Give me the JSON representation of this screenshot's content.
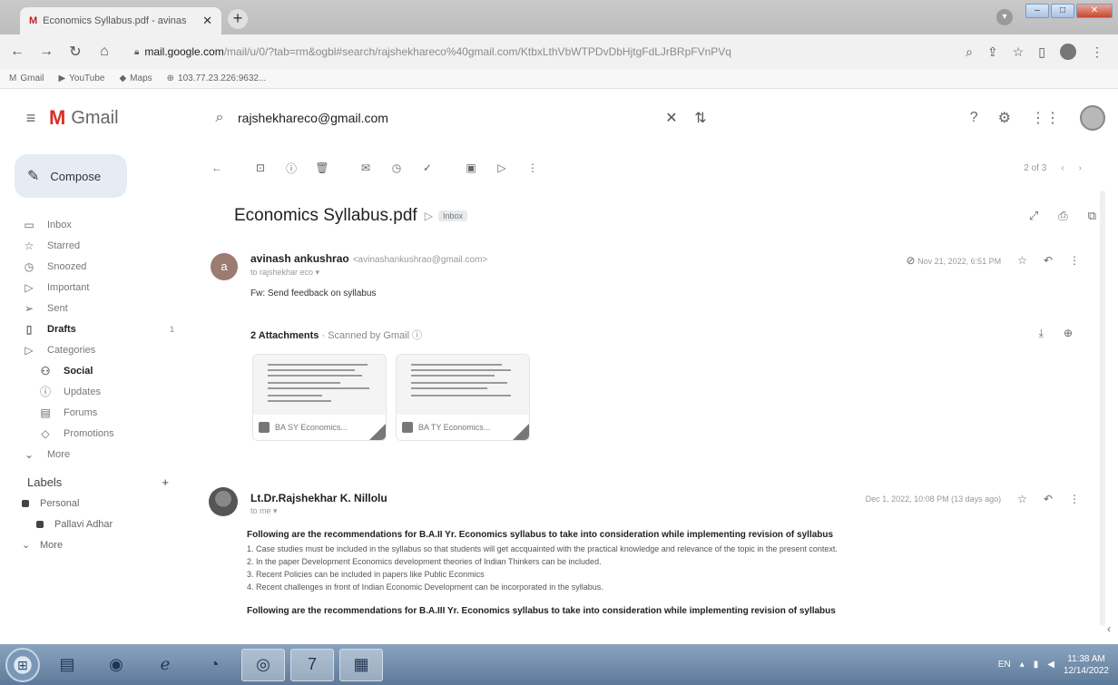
{
  "browser": {
    "tab_title": "Economics Syllabus.pdf - avinas",
    "tab_favicon": "M",
    "url_host": "mail.google.com",
    "url_path": "/mail/u/0/?tab=rm&ogbl#search/rajshekhareco%40gmail.com/KtbxLthVbWTPDvDbHjtgFdLJrBRpFVnPVq",
    "bookmarks": [
      "Gmail",
      "YouTube",
      "Maps",
      "103.77.23.226:9632..."
    ]
  },
  "gmail": {
    "app_name": "Gmail",
    "search_value": "rajshekhareco@gmail.com"
  },
  "sidebar": {
    "compose_label": "Compose",
    "items": [
      {
        "label": "Inbox"
      },
      {
        "label": "Starred"
      },
      {
        "label": "Snoozed"
      },
      {
        "label": "Important"
      },
      {
        "label": "Sent"
      },
      {
        "label": "Drafts",
        "count": "1"
      },
      {
        "label": "Categories"
      },
      {
        "label": "Social"
      },
      {
        "label": "Updates"
      },
      {
        "label": "Forums"
      },
      {
        "label": "Promotions"
      },
      {
        "label": "More"
      }
    ],
    "labels_title": "Labels",
    "labels": [
      {
        "label": "Personal"
      },
      {
        "label": "Pallavi Adhar"
      },
      {
        "label": "More"
      }
    ]
  },
  "toolbar": {
    "pager_text": "2 of 3"
  },
  "thread": {
    "subject": "Economics Syllabus.pdf",
    "tag": "Inbox",
    "message1": {
      "avatar_letter": "a",
      "sender": "avinash ankushrao",
      "email": "<avinashankushrao@gmail.com>",
      "to": "to rajshekhar eco",
      "date": "Nov 21, 2022, 6:51 PM",
      "snippet": "Fw: Send feedback on syllabus"
    },
    "attachments_title": "2 Attachments",
    "scanned_by": "Scanned by Gmail",
    "attachments": [
      {
        "name": "BA SY Economics..."
      },
      {
        "name": "BA TY Economics..."
      }
    ],
    "message2": {
      "sender": "Lt.Dr.Rajshekhar K. Nillolu",
      "to": "to me",
      "date": "Dec 1, 2022, 10:08 PM (13 days ago)",
      "lead": "Following are the recommendations for B.A.II Yr. Economics syllabus to take into consideration while implementing revision of syllabus",
      "points": [
        "1. Case studies must be included in the syllabus so that students will get accquainted with the practical knowledge and relevance of the topic in the present context.",
        "2. In the paper Development Economics development theories of Indian Thinkers can be included.",
        "3. Recent Policies can be included in papers like Public Econmics",
        "4. Recent challenges in front of Indian Economic Development can be incorporated in the syllabus."
      ],
      "lead2": "Following are the recommendations for B.A.III Yr. Economics syllabus to take into consideration while implementing revision of syllabus"
    }
  },
  "taskbar": {
    "lang": "EN",
    "time": "11:38 AM",
    "date": "12/14/2022"
  }
}
